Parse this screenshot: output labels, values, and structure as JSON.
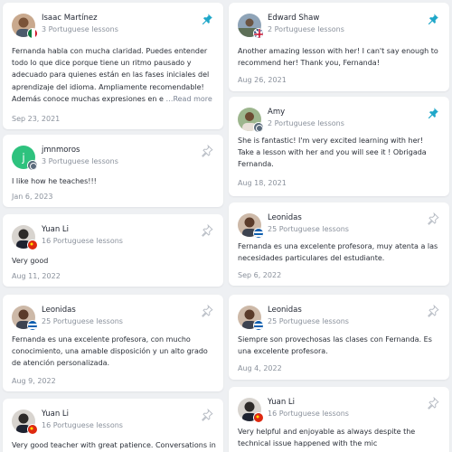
{
  "colors": {
    "page_bg": "#eef0f3",
    "card_bg": "#ffffff",
    "pin_active": "#1fa7c9",
    "pin_inactive": "#b9bec6",
    "meta_text": "#8a919c"
  },
  "left_column": [
    {
      "name": "Isaac Martínez",
      "lessons": "3 Portuguese lessons",
      "text": "Fernanda habla con mucha claridad. Puedes entender todo lo que dice porque tiene un ritmo pausado y adecuado para quienes están en las fases iniciales del aprendizaje del idioma. Ampliamente recomendable! Además conoce muchas expresiones en e",
      "read_more": "…Read more",
      "date": "Sep 23, 2021",
      "pinned": true,
      "flag": "mexico-flag-icon"
    },
    {
      "name": "jmnmoros",
      "lessons": "3 Portuguese lessons",
      "text": "I like how he teaches!!!",
      "date": "Jan 6, 2023",
      "pinned": false,
      "flag": "globe-flag-icon"
    },
    {
      "name": "Yuan Li",
      "lessons": "16 Portuguese lessons",
      "text": "Very good",
      "date": "Aug 11, 2022",
      "pinned": false,
      "flag": "china-flag-icon"
    },
    {
      "name": "Leonidas",
      "lessons": "25 Portuguese lessons",
      "text": "Fernanda es una excelente profesora, con mucho conocimiento, una amable disposición y un alto grado de atención personalizada.",
      "date": "Aug 9, 2022",
      "pinned": false,
      "flag": "greece-flag-icon"
    },
    {
      "name": "Yuan Li",
      "lessons": "16 Portuguese lessons",
      "text": "Very good teacher with great patience. Conversations in",
      "date": "",
      "pinned": false,
      "flag": "china-flag-icon"
    }
  ],
  "right_column": [
    {
      "name": "Edward Shaw",
      "lessons": "2 Portuguese lessons",
      "text": "Another amazing lesson with her! I can't say enough to recommend her! Thank you, Fernanda!",
      "date": "Aug 26, 2021",
      "pinned": true,
      "flag": "uk-flag-icon"
    },
    {
      "name": "Amy",
      "lessons": "2 Portuguese lessons",
      "text": "She is fantastic! I'm very excited learning with her! Take a lesson with her and you will see it ! Obrigada Fernanda.",
      "date": "Aug 18, 2021",
      "pinned": true,
      "flag": "globe-flag-icon"
    },
    {
      "name": "Leonidas",
      "lessons": "25 Portuguese lessons",
      "text": "Fernanda es una excelente profesora, muy atenta a las necesidades particulares del estudiante.",
      "date": "Sep 6, 2022",
      "pinned": false,
      "flag": "greece-flag-icon"
    },
    {
      "name": "Leonidas",
      "lessons": "25 Portuguese lessons",
      "text": "Siempre son provechosas las clases con Fernanda. Es una excelente profesora.",
      "date": "Aug 4, 2022",
      "pinned": false,
      "flag": "greece-flag-icon"
    },
    {
      "name": "Yuan Li",
      "lessons": "16 Portuguese lessons",
      "text": "Very helpful and enjoyable as always despite the technical issue happened with the mic",
      "date": "",
      "pinned": false,
      "flag": "china-flag-icon"
    }
  ]
}
